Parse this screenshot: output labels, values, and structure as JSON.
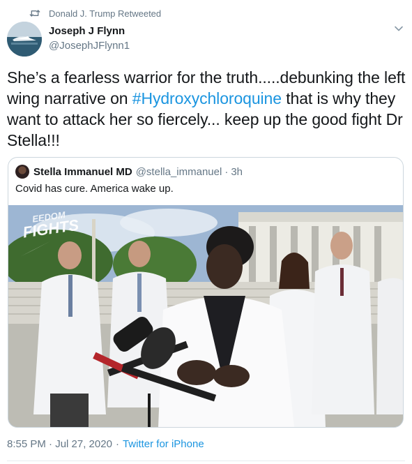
{
  "retweet_bar": {
    "icon": "retweet-icon",
    "text": "Donald J. Trump Retweeted"
  },
  "author": {
    "name": "Joseph J Flynn",
    "handle": "@JosephJFlynn1",
    "avatar_icon": "profile-avatar"
  },
  "menu": {
    "icon": "chevron-down-icon"
  },
  "tweet": {
    "text_before": "She’s a fearless warrior for the truth.....debunking the left wing narrative on ",
    "hashtag": "#Hydroxychloroquine",
    "text_after": " that is why they want to attack her so fiercely... keep up the good fight Dr Stella!!!"
  },
  "quoted_tweet": {
    "name": "Stella Immanuel MD",
    "handle": "@stella_immanuel",
    "separator": "·",
    "time": "3h",
    "text": "Covid has cure. America wake up.",
    "media_overlay_text": "FREEDOM FIGHTS"
  },
  "meta": {
    "timestamp": "8:55 PM · Jul 27, 2020",
    "separator": "·",
    "source": "Twitter for iPhone"
  },
  "colors": {
    "text": "#14171a",
    "secondary": "#657786",
    "link": "#1b95e0",
    "border": "#ccd6dd"
  }
}
